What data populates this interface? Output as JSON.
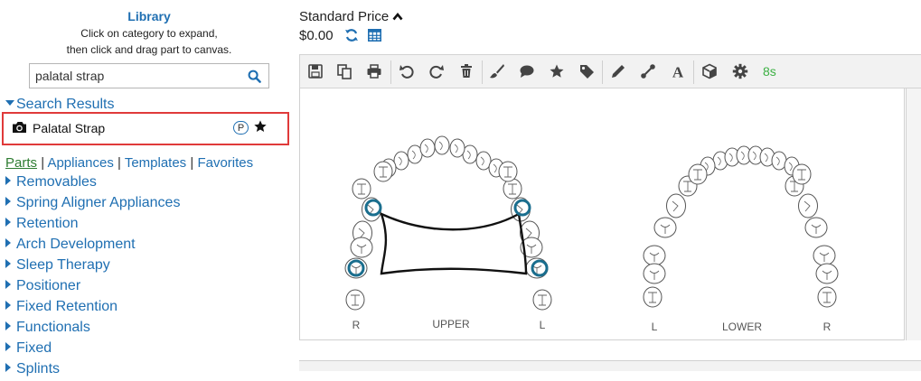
{
  "library": {
    "title": "Library",
    "instruction_line1": "Click on category to expand,",
    "instruction_line2": "then click and drag part to canvas.",
    "search": {
      "value": "palatal strap",
      "placeholder": ""
    },
    "results_header": "Search Results",
    "results": [
      {
        "label": "Palatal Strap",
        "badge": "P"
      }
    ],
    "nav": {
      "parts": "Parts",
      "sep": "|",
      "appliances": "Appliances",
      "templates": "Templates",
      "favorites": "Favorites"
    },
    "categories": [
      "Removables",
      "Spring Aligner Appliances",
      "Retention",
      "Arch Development",
      "Sleep Therapy",
      "Positioner",
      "Fixed Retention",
      "Functionals",
      "Fixed",
      "Splints"
    ]
  },
  "price": {
    "title": "Standard Price",
    "value": "$0.00"
  },
  "toolbar": {
    "timer": "8s",
    "icons": [
      "save-icon",
      "copy-icon",
      "print-icon",
      "undo-icon",
      "redo-icon",
      "delete-icon",
      "brush-icon",
      "comment-icon",
      "star-icon",
      "tag-icon",
      "pencil-icon",
      "connector-icon",
      "text-icon",
      "cube-icon",
      "gear-icon"
    ]
  },
  "canvas": {
    "upper": {
      "label": "UPPER",
      "left": "R",
      "right": "L"
    },
    "lower": {
      "label": "LOWER",
      "left": "L",
      "right": "R"
    }
  },
  "colors": {
    "accent": "#1f6fb2",
    "highlight": "#e03a3a",
    "timer": "#3cb043",
    "marker": "#1a6e8e"
  }
}
